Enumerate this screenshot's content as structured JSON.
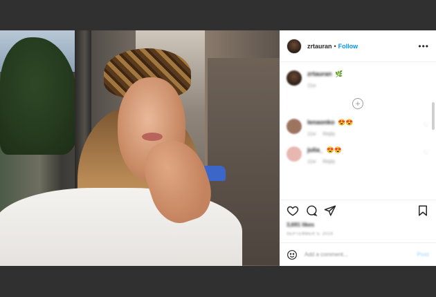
{
  "post": {
    "username": "zrtauran",
    "separator": "•",
    "follow_label": "Follow",
    "more_icon": "more-options-icon"
  },
  "comments": {
    "caption": {
      "username": "zrtauran",
      "emoji": "🌿",
      "time": "11w"
    },
    "load_more_label": "+",
    "items": [
      {
        "username": "lenaonko",
        "emoji": "😍😍",
        "time": "11w",
        "reply_label": "Reply",
        "avatar_color": "#9c7460"
      },
      {
        "username": "julia_",
        "emoji": "😍😍",
        "time": "11w",
        "reply_label": "Reply",
        "avatar_color": "#e8b8b0"
      }
    ]
  },
  "actions": {
    "likes": "3,691 likes",
    "date": "SEPTEMBER 5, 2019",
    "icons": [
      "heart-icon",
      "comment-icon",
      "share-icon",
      "bookmark-icon"
    ]
  },
  "add_comment": {
    "placeholder": "Add a comment...",
    "post_label": "Post"
  },
  "colors": {
    "background": "#303030",
    "accent": "#0095f6",
    "post_disabled": "#b2dffc"
  }
}
